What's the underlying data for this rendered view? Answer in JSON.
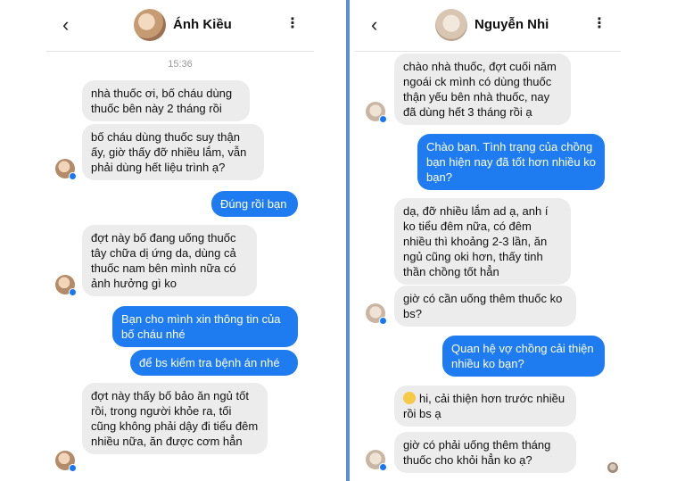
{
  "left_chat": {
    "header": {
      "name": "Ánh Kiều",
      "back_icon": "‹",
      "menu_icon": "⋮"
    },
    "timestamp": "15:36",
    "messages": [
      {
        "dir": "in",
        "text": "nhà thuốc ơi, bố cháu dùng thuốc  bên này 2 tháng rồi"
      },
      {
        "dir": "in",
        "text": "bố cháu dùng thuốc suy thận ấy, giờ thấy đỡ  nhiều lắm, vẫn phải dùng hết liệu trình ạ?"
      },
      {
        "dir": "out",
        "text": "Đúng rồi bạn"
      },
      {
        "dir": "in",
        "text": "đợt này bố đang uống thuốc tây chữa dị ứng da, dùng cả thuốc nam bên mình nữa có ảnh hưởng gì ko"
      },
      {
        "dir": "out",
        "text": "Bạn cho mình xin thông tin của bố cháu nhé"
      },
      {
        "dir": "out",
        "text": "để bs kiểm tra bệnh án nhé"
      },
      {
        "dir": "in",
        "text": "đợt này thấy bố bảo ăn ngủ tốt rồi, trong người khỏe ra, tối cũng không phải dậy đi tiểu đêm nhiều nữa, ăn được cơm hẳn"
      }
    ]
  },
  "right_chat": {
    "header": {
      "name": "Nguyễn Nhi",
      "back_icon": "‹",
      "menu_icon": "⋮"
    },
    "messages": [
      {
        "dir": "in",
        "text": "chào nhà thuốc, đợt cuối năm ngoái ck mình có dùng thuốc thận yếu bên nhà thuốc, nay đã dùng hết 3 tháng rồi ạ"
      },
      {
        "dir": "out",
        "text": "Chào bạn. Tình trạng của chồng bạn hiện nay đã tốt hơn nhiều ko bạn?"
      },
      {
        "dir": "in",
        "text": "dạ, đỡ nhiều lắm ad ạ, anh í ko tiểu đêm nữa,  có đêm nhiều thì khoảng 2-3 lần, ăn ngủ cũng oki hơn, thấy tinh thần chồng tốt hẳn"
      },
      {
        "dir": "in",
        "text": "giờ có cần uống thêm thuốc ko bs?"
      },
      {
        "dir": "out",
        "text": "Quan hệ vợ chồng cải thiện nhiều ko bạn?"
      },
      {
        "dir": "in",
        "text": "hi, cải thiện hơn trước nhiều rồi  bs ạ",
        "emoji": "smiling-face-icon"
      },
      {
        "dir": "in",
        "text": "giờ có phải uống thêm tháng thuốc cho khỏi hẳn ko ạ?"
      }
    ]
  },
  "colors": {
    "outgoing": "#1f7cf0",
    "incoming": "#ececec",
    "divider": "#5b8fd4"
  }
}
